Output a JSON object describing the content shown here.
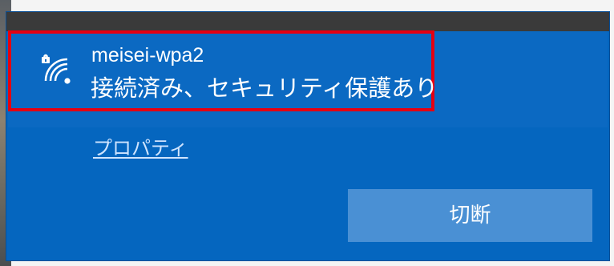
{
  "network": {
    "name": "meisei-wpa2",
    "status": "接続済み、セキュリティ保護あり",
    "icon": "wifi-secured-icon"
  },
  "links": {
    "properties": "プロパティ"
  },
  "buttons": {
    "disconnect": "切断"
  },
  "colors": {
    "panel_bg": "#0566bf",
    "button_bg": "#4a90d4",
    "highlight": "#e50012",
    "text": "#ffffff"
  }
}
